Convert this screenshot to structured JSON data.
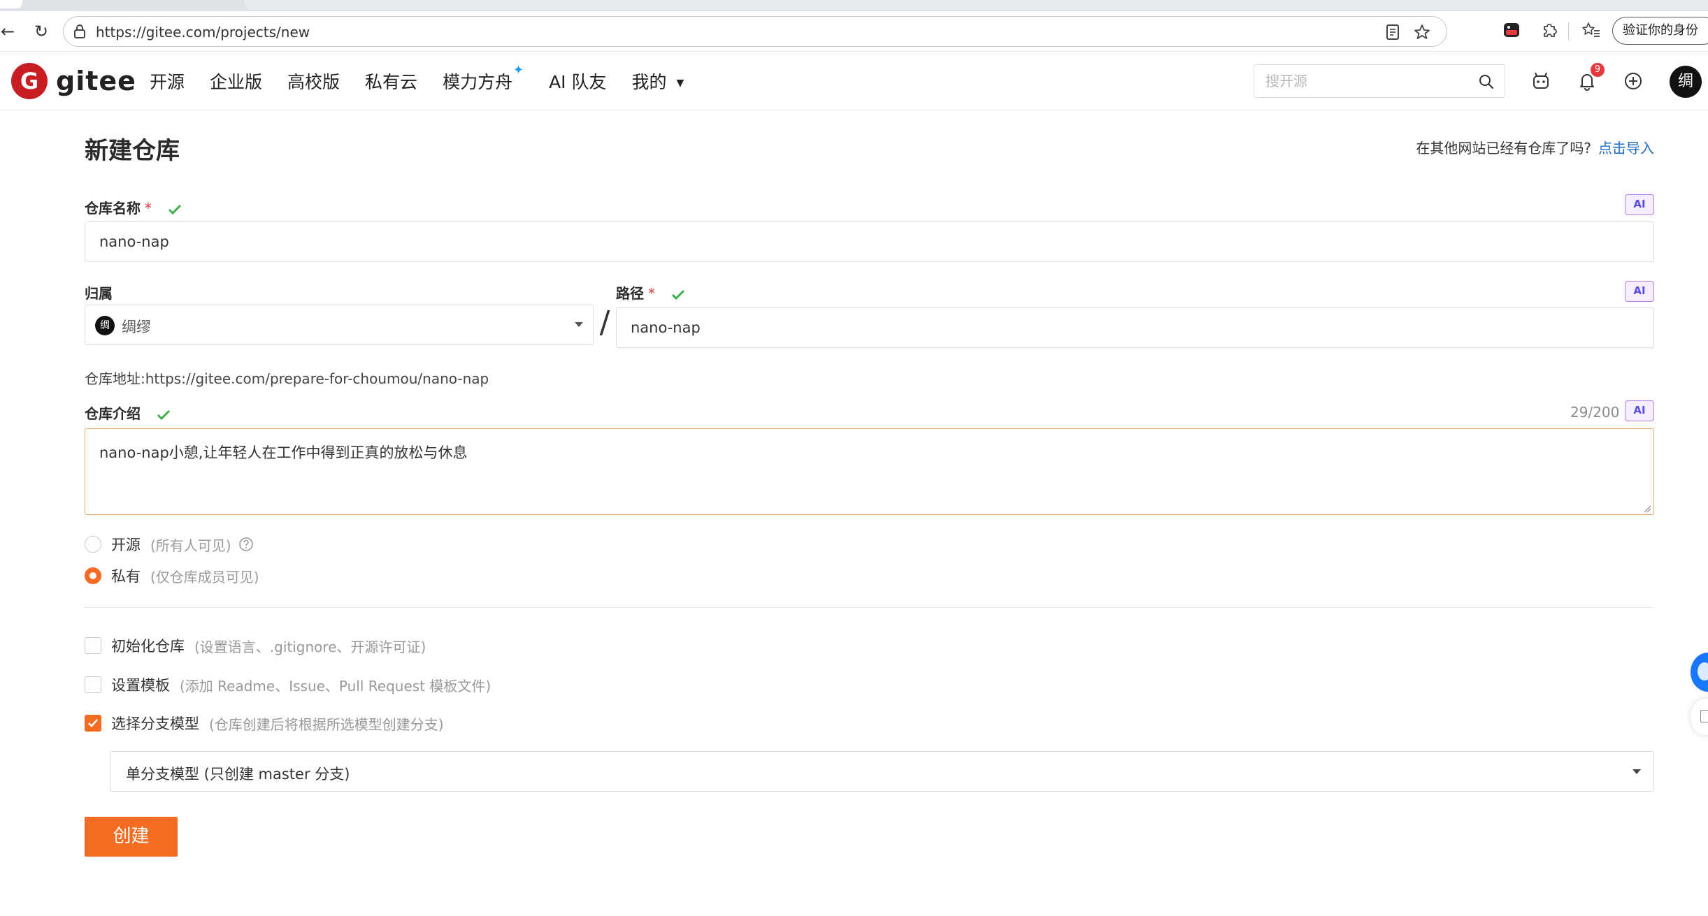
{
  "browser": {
    "url": "https://gitee.com/projects/new",
    "verify_label": "验证你的身份"
  },
  "header": {
    "logo_text": "gitee",
    "logo_letter": "G",
    "nav": [
      {
        "label": "开源"
      },
      {
        "label": "企业版"
      },
      {
        "label": "高校版"
      },
      {
        "label": "私有云"
      },
      {
        "label": "模力方舟"
      },
      {
        "label": "AI 队友"
      },
      {
        "label": "我的"
      }
    ],
    "search_placeholder": "搜开源",
    "notification_count": "9",
    "avatar_char": "绸"
  },
  "page": {
    "title": "新建仓库",
    "import_prompt": "在其他网站已经有仓库了吗?",
    "import_link": "点击导入"
  },
  "form": {
    "ai_label": "AI",
    "required_mark": "*",
    "name_label": "仓库名称",
    "name_value": "nano-nap",
    "owner_label": "归属",
    "owner_avatar_char": "绸",
    "owner_name": "绸缪",
    "slash": "/",
    "path_label": "路径",
    "path_value": "nano-nap",
    "repo_url_label": "仓库地址:",
    "repo_url_value": "https://gitee.com/prepare-for-choumou/nano-nap",
    "desc_label": "仓库介绍",
    "desc_counter": "29/200",
    "desc_value": "nano-nap小憩,让年轻人在工作中得到正真的放松与休息",
    "visibility": [
      {
        "label": "开源",
        "note": "(所有人可见)",
        "checked": false
      },
      {
        "label": "私有",
        "note": "(仅仓库成员可见)",
        "checked": true
      }
    ],
    "options": [
      {
        "label": "初始化仓库",
        "note": "(设置语言、.gitignore、开源许可证)",
        "checked": false
      },
      {
        "label": "设置模板",
        "note": "(添加 Readme、Issue、Pull Request 模板文件)",
        "checked": false
      },
      {
        "label": "选择分支模型",
        "note": "(仓库创建后将根据所选模型创建分支)",
        "checked": true
      }
    ],
    "branch_model_value": "单分支模型 (只创建 master 分支)",
    "submit_label": "创建"
  },
  "colors": {
    "accent": "#f36c21",
    "brand": "#c71d23",
    "link": "#1a6bc5",
    "success": "#3fae4f"
  }
}
